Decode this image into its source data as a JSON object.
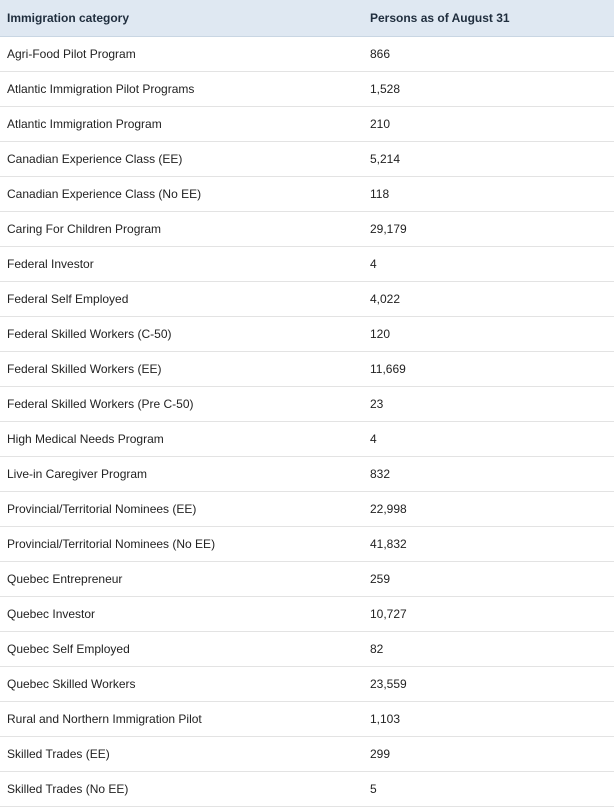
{
  "table": {
    "headers": [
      "Immigration category",
      "Persons as of August 31"
    ],
    "rows": [
      [
        "Agri-Food Pilot Program",
        "866"
      ],
      [
        "Atlantic Immigration Pilot Programs",
        "1,528"
      ],
      [
        "Atlantic Immigration Program",
        "210"
      ],
      [
        "Canadian Experience Class (EE)",
        "5,214"
      ],
      [
        "Canadian Experience Class (No EE)",
        "118"
      ],
      [
        "Caring For Children Program",
        "29,179"
      ],
      [
        "Federal Investor",
        "4"
      ],
      [
        "Federal Self Employed",
        "4,022"
      ],
      [
        "Federal Skilled Workers (C-50)",
        "120"
      ],
      [
        "Federal Skilled Workers (EE)",
        "11,669"
      ],
      [
        "Federal Skilled Workers (Pre C-50)",
        "23"
      ],
      [
        "High Medical Needs Program",
        "4"
      ],
      [
        "Live-in Caregiver Program",
        "832"
      ],
      [
        "Provincial/Territorial Nominees (EE)",
        "22,998"
      ],
      [
        "Provincial/Territorial Nominees (No EE)",
        "41,832"
      ],
      [
        "Quebec Entrepreneur",
        "259"
      ],
      [
        "Quebec Investor",
        "10,727"
      ],
      [
        "Quebec Self Employed",
        "82"
      ],
      [
        "Quebec Skilled Workers",
        "23,559"
      ],
      [
        "Rural and Northern Immigration Pilot",
        "1,103"
      ],
      [
        "Skilled Trades (EE)",
        "299"
      ],
      [
        "Skilled Trades (No EE)",
        "5"
      ]
    ]
  }
}
